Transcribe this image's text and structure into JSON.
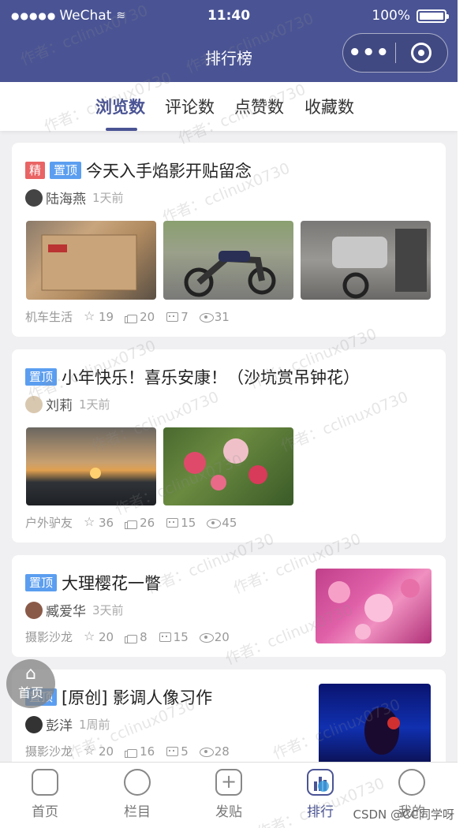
{
  "status_bar": {
    "carrier": "WeChat",
    "time": "11:40",
    "battery": "100%"
  },
  "nav": {
    "title": "排行榜"
  },
  "tabs": [
    {
      "label": "浏览数",
      "active": true
    },
    {
      "label": "评论数",
      "active": false
    },
    {
      "label": "点赞数",
      "active": false
    },
    {
      "label": "收藏数",
      "active": false
    }
  ],
  "posts": [
    {
      "badges": [
        "精",
        "置顶"
      ],
      "title": "今天入手焰影开贴留念",
      "author": "陆海燕",
      "time": "1天前",
      "category": "机车生活",
      "stars": "19",
      "likes": "20",
      "comments": "7",
      "views": "31"
    },
    {
      "badges": [
        "置顶"
      ],
      "title": "小年快乐！喜乐安康！（沙坑赏吊钟花）",
      "author": "刘莉",
      "time": "1天前",
      "category": "户外驴友",
      "stars": "36",
      "likes": "26",
      "comments": "15",
      "views": "45"
    },
    {
      "badges": [
        "置顶"
      ],
      "title": "大理樱花一瞥",
      "author": "臧爱华",
      "time": "3天前",
      "category": "摄影沙龙",
      "stars": "20",
      "likes": "8",
      "comments": "15",
      "views": "20"
    },
    {
      "badges": [
        "置顶"
      ],
      "title": "[原创] 影调人像习作",
      "author": "彭洋",
      "time": "1周前",
      "category": "摄影沙龙",
      "stars": "20",
      "likes": "16",
      "comments": "5",
      "views": "28"
    }
  ],
  "tabbar": [
    {
      "label": "首页",
      "icon": "home-icon",
      "active": false
    },
    {
      "label": "栏目",
      "icon": "chat-icon",
      "active": false
    },
    {
      "label": "发贴",
      "icon": "add-post-icon",
      "active": false
    },
    {
      "label": "排行",
      "icon": "ranking-icon",
      "active": true
    },
    {
      "label": "我的",
      "icon": "user-icon",
      "active": false
    }
  ],
  "home_float": {
    "label": "首页"
  },
  "watermark": "作者：cclinux0730",
  "csdn_credit": "CSDN @CC同学呀",
  "colors": {
    "primary": "#4a5494",
    "badge_jing": "#e96464",
    "badge_top": "#5b9ef0"
  }
}
